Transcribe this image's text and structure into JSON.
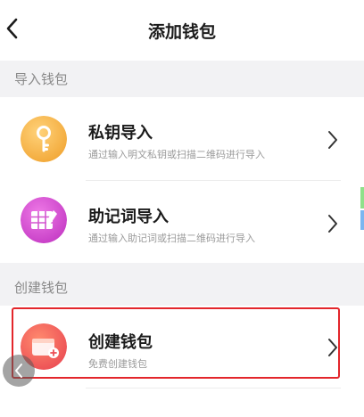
{
  "header": {
    "title": "添加钱包",
    "back_icon": "chevron-left-icon"
  },
  "sections": [
    {
      "label": "导入钱包",
      "items": [
        {
          "title": "私钥导入",
          "subtitle": "通过输入明文私钥或扫描二维码进行导入",
          "icon": "key-icon",
          "icon_color": "#f5b84a"
        },
        {
          "title": "助记词导入",
          "subtitle": "通过输入助记词或扫描二维码进行导入",
          "icon": "word-grid-icon",
          "icon_color": "#d94fd6"
        }
      ]
    },
    {
      "label": "创建钱包",
      "items": [
        {
          "title": "创建钱包",
          "subtitle": "免费创建钱包",
          "icon": "wallet-icon",
          "icon_color": "#f0605a",
          "highlighted": true
        }
      ]
    }
  ],
  "colors": {
    "highlight_border": "#e3262b",
    "background": "#f2f2f4"
  }
}
